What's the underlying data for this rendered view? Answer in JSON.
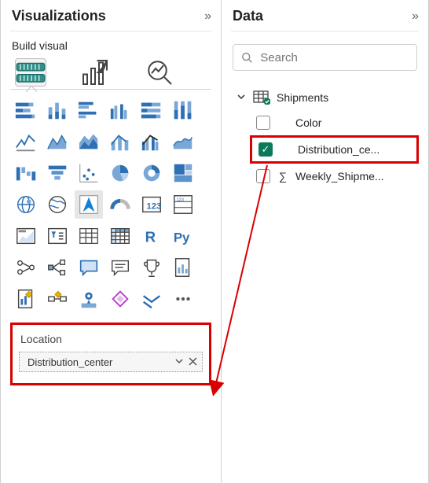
{
  "viz": {
    "title": "Visualizations",
    "subtitle": "Build visual",
    "collapse_glyph": "»",
    "tabs": [
      "build",
      "format",
      "analytics"
    ],
    "well": {
      "label": "Location",
      "field": "Distribution_center"
    }
  },
  "data": {
    "title": "Data",
    "collapse_glyph": "»",
    "search_placeholder": "Search",
    "table": {
      "name": "Shipments",
      "fields": [
        {
          "name": "Color",
          "checked": false,
          "agg": false
        },
        {
          "name": "Distribution_ce...",
          "checked": true,
          "agg": false
        },
        {
          "name": "Weekly_Shipme...",
          "checked": false,
          "agg": true
        }
      ]
    }
  }
}
